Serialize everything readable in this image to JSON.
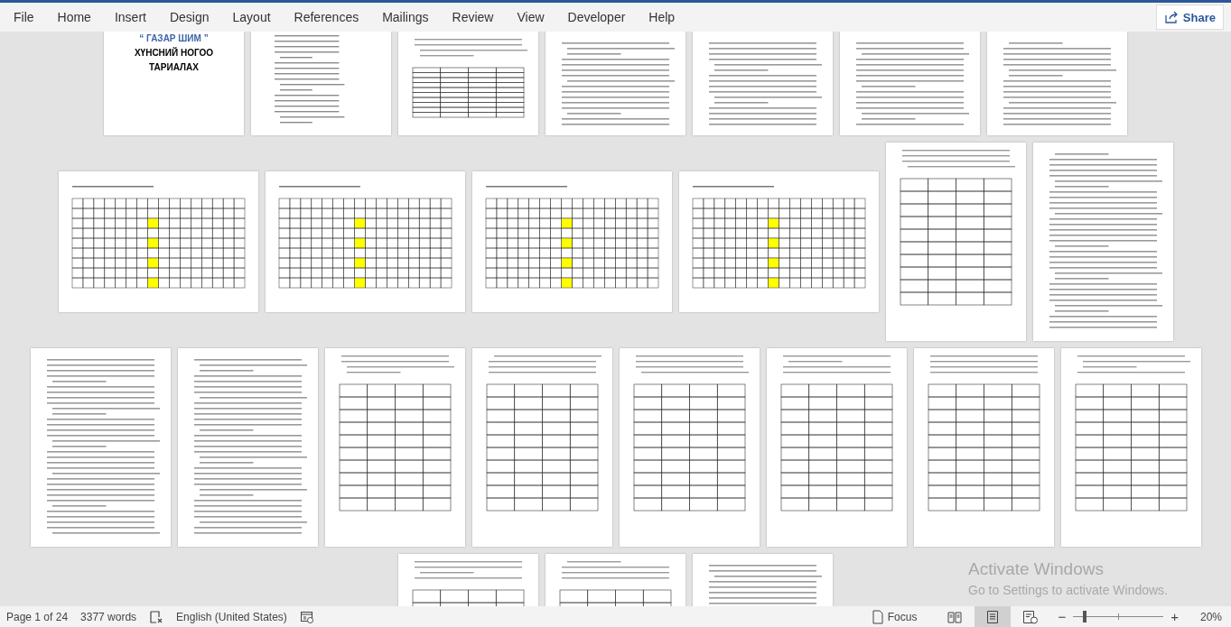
{
  "menu": [
    {
      "label": "File"
    },
    {
      "label": "Home"
    },
    {
      "label": "Insert"
    },
    {
      "label": "Design"
    },
    {
      "label": "Layout"
    },
    {
      "label": "References"
    },
    {
      "label": "Mailings"
    },
    {
      "label": "Review"
    },
    {
      "label": "View"
    },
    {
      "label": "Developer"
    },
    {
      "label": "Help"
    }
  ],
  "share_button": {
    "label": "Share"
  },
  "page_rows": [
    {
      "pages": [
        {
          "kind": "title",
          "title_lines": [
            {
              "text": "“ ГАЗАР ШИМ ”",
              "accent": true
            },
            {
              "text": "ХҮНСНИЙ НОГОО",
              "accent": false
            },
            {
              "text": "ТАРИАЛАХ",
              "accent": false
            }
          ]
        },
        {
          "kind": "contents"
        },
        {
          "kind": "table"
        },
        {
          "kind": "text"
        },
        {
          "kind": "text"
        },
        {
          "kind": "text"
        },
        {
          "kind": "text"
        }
      ]
    },
    {
      "pages": [
        {
          "kind": "wide-table"
        },
        {
          "kind": "wide-table"
        },
        {
          "kind": "wide-table"
        },
        {
          "kind": "wide-table"
        },
        {
          "kind": "table"
        },
        {
          "kind": "text"
        }
      ]
    },
    {
      "pages": [
        {
          "kind": "text"
        },
        {
          "kind": "text"
        },
        {
          "kind": "table"
        },
        {
          "kind": "table"
        },
        {
          "kind": "table"
        },
        {
          "kind": "table"
        },
        {
          "kind": "table"
        },
        {
          "kind": "table"
        }
      ]
    },
    {
      "pages": [
        {
          "kind": "table"
        },
        {
          "kind": "table"
        },
        {
          "kind": "text"
        }
      ]
    }
  ],
  "activation_notice": {
    "title": "Activate Windows",
    "hint": "Go to Settings to activate Windows."
  },
  "status_bar": {
    "page": "Page 1 of 24",
    "words": "3377 words",
    "language": "English (United States)",
    "focus": "Focus",
    "views": [
      {
        "kind": "read",
        "selected": false
      },
      {
        "kind": "print",
        "selected": true
      },
      {
        "kind": "web",
        "selected": false
      }
    ],
    "zoom": {
      "out": "−",
      "in": "+",
      "level": 0.13,
      "reading": "20%"
    }
  }
}
